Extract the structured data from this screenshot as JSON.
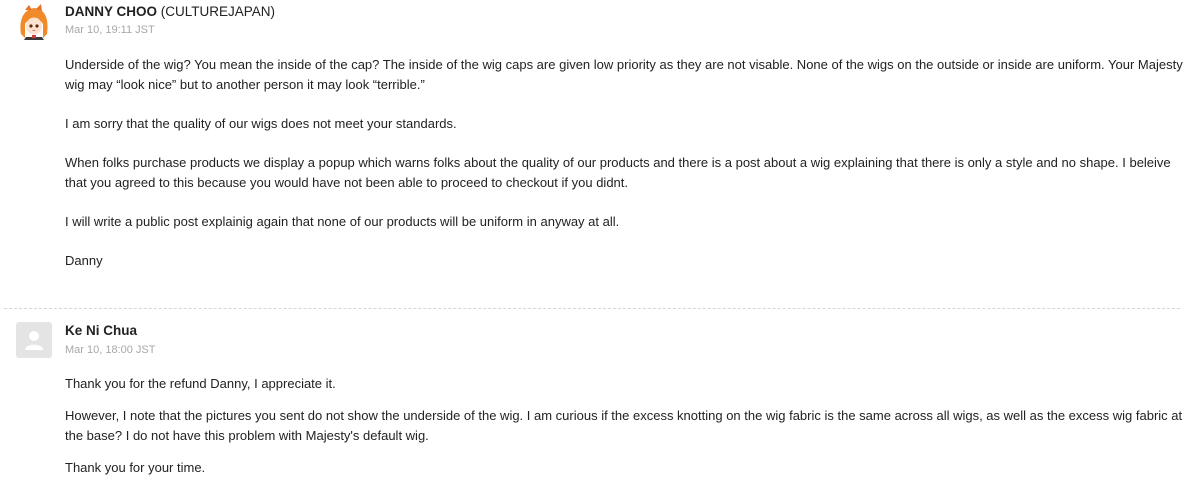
{
  "thread": {
    "messages": [
      {
        "author": "DANNY CHOO",
        "org": "(CULTUREJAPAN)",
        "timestamp": "Mar 10, 19:11 JST",
        "avatar_icon": "anime-character-avatar",
        "paragraphs": [
          "Underside of the wig? You mean the inside of the cap? The inside of the wig caps are given low priority as they are not visable. None of the wigs on the outside or inside are uniform. Your Majesty wig may “look nice” but to another person it may look “terrible.”",
          "I am sorry that the quality of our wigs does not meet your standards.",
          "When folks purchase products we display a popup which warns folks about the quality of our products and there is a post about a wig explaining that there is only a style and no shape. I beleive that you agreed to this because you would have not been able to proceed to checkout if you didnt.",
          "I will write a public post explainig again that none of our products will be uniform in anyway at all.",
          "Danny"
        ]
      },
      {
        "author": "Ke Ni Chua",
        "timestamp": "Mar 10, 18:00 JST",
        "avatar_icon": "default-user-avatar",
        "paragraphs": [
          "Thank you for the refund Danny, I appreciate it.",
          "However, I note that the pictures you sent do not show the underside of the wig. I am curious if the excess knotting on the wig fabric is the same across all wigs, as well as the excess wig fabric at the base? I do not have this problem with Majesty's default wig.",
          "Thank you for your time."
        ]
      }
    ]
  },
  "colors": {
    "text": "#222222",
    "timestamp": "#a8a8a8",
    "divider": "#d6d6d6",
    "avatar_placeholder": "#e4e4e4",
    "avatar_hair": "#f08a2a"
  }
}
